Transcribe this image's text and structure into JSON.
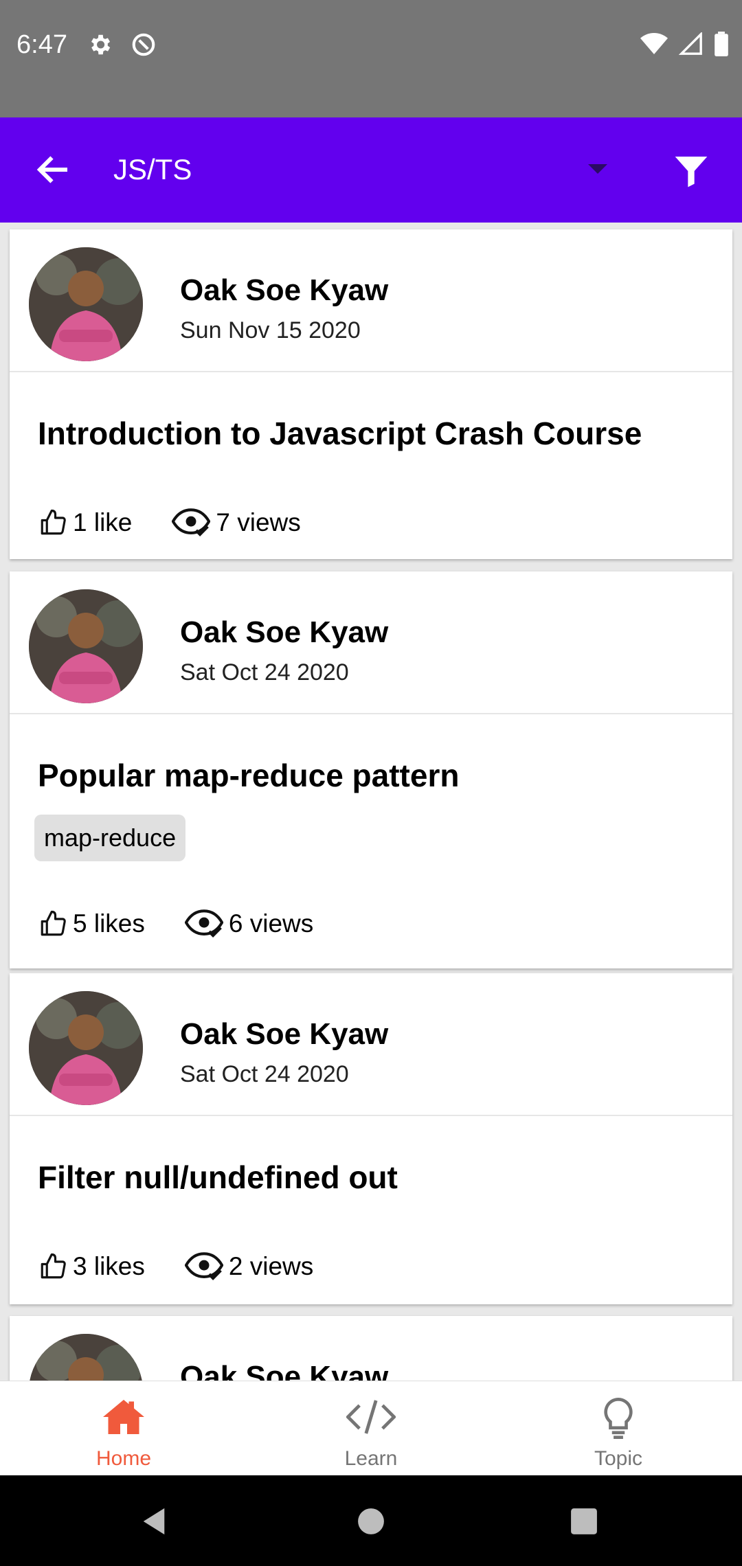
{
  "status_bar": {
    "time": "6:47"
  },
  "app_bar": {
    "title": "JS/TS"
  },
  "posts": [
    {
      "author": "Oak Soe Kyaw",
      "date": "Sun Nov 15 2020",
      "title": "Introduction to Javascript Crash Course",
      "tags": [],
      "likes": "1 like",
      "views": "7 views"
    },
    {
      "author": "Oak Soe Kyaw",
      "date": "Sat Oct 24 2020",
      "title": "Popular map-reduce pattern",
      "tags": [
        "map-reduce"
      ],
      "likes": "5 likes",
      "views": "6 views"
    },
    {
      "author": "Oak Soe Kyaw",
      "date": "Sat Oct 24 2020",
      "title": "Filter null/undefined out",
      "tags": [],
      "likes": "3 likes",
      "views": "2 views"
    },
    {
      "author": "Oak Soe Kyaw"
    }
  ],
  "bottom_nav": {
    "items": [
      {
        "label": "Home",
        "icon": "home-icon",
        "active": true
      },
      {
        "label": "Learn",
        "icon": "code-icon",
        "active": false
      },
      {
        "label": "Topic",
        "icon": "lightbulb-icon",
        "active": false
      }
    ]
  },
  "colors": {
    "app_bar": "#6200ee",
    "status_bar": "#767676",
    "active_nav": "#f05a3c"
  }
}
